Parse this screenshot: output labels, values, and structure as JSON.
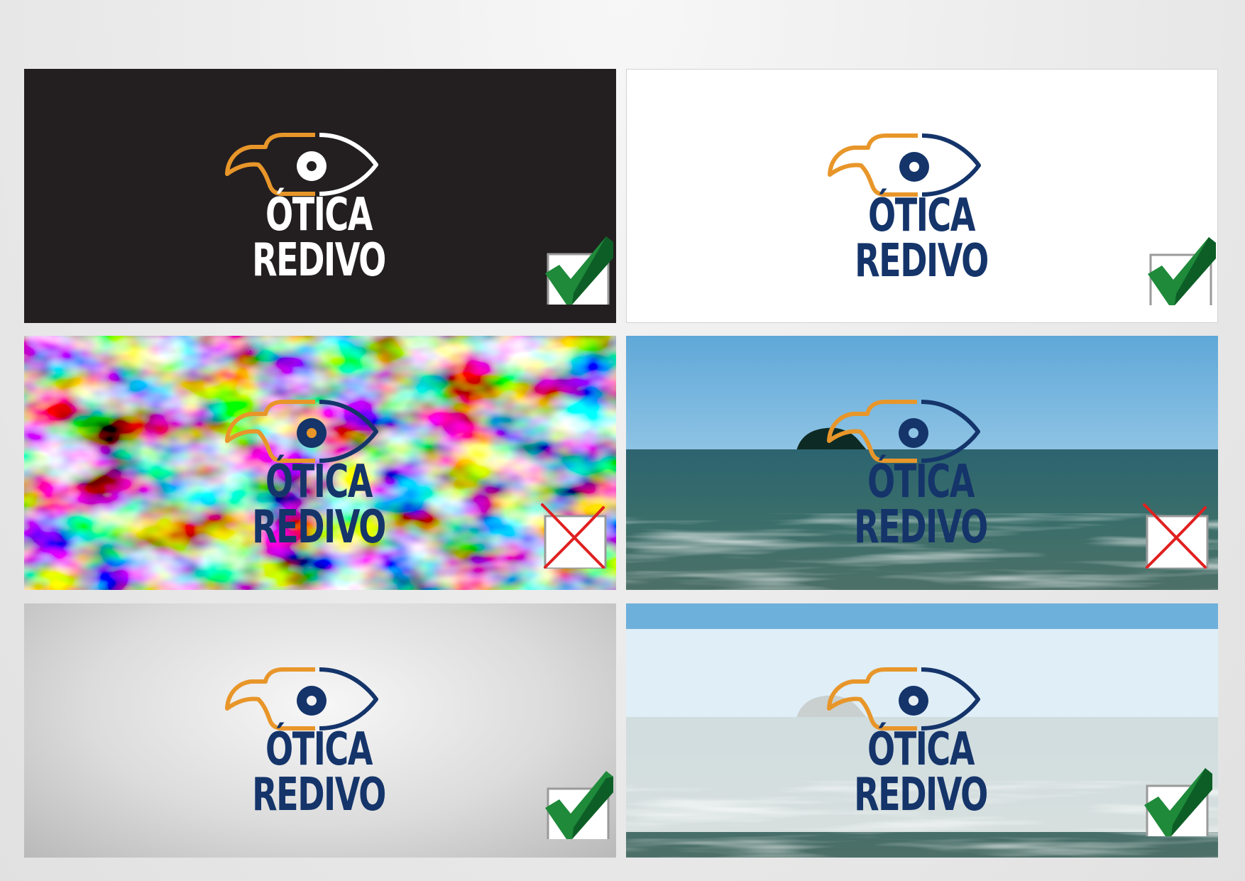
{
  "colors": {
    "orange": "#e8962a",
    "navy": "#14346a",
    "white": "#ffffff",
    "black_background": "#231f20",
    "approved_green": "#1e8a3a",
    "rejected_red": "#e02020"
  },
  "panels": [
    {
      "brand": "ÓTICA REDIVO",
      "background": "black",
      "verdict": "approved",
      "verdict_icon": "check-mark-icon"
    },
    {
      "brand": "ÓTICA REDIVO",
      "background": "white",
      "verdict": "approved",
      "verdict_icon": "check-mark-icon"
    },
    {
      "brand": "ÓTICA REDIVO",
      "background": "multicolor texture",
      "verdict": "rejected",
      "verdict_icon": "cross-mark-icon"
    },
    {
      "brand": "ÓTICA REDIVO",
      "background": "sea photo",
      "verdict": "rejected",
      "verdict_icon": "cross-mark-icon"
    },
    {
      "brand": "ÓTICA REDIVO",
      "background": "gray gradient",
      "verdict": "approved",
      "verdict_icon": "check-mark-icon"
    },
    {
      "brand": "ÓTICA REDIVO",
      "background": "faded sea photo",
      "verdict": "approved",
      "verdict_icon": "check-mark-icon"
    }
  ]
}
